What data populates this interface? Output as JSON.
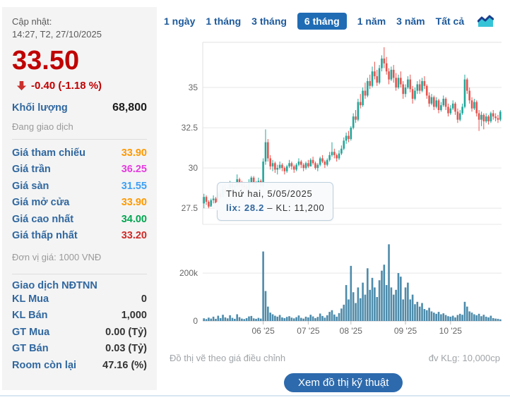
{
  "panel": {
    "updated_label": "Cập nhật:",
    "updated_time": "14:27, T2, 27/10/2025",
    "price": "33.50",
    "change": "-0.40 (-1.18 %)",
    "volume_label": "Khối lượng",
    "volume_value": "68,800",
    "session_status": "Đang giao dịch",
    "price_rows": [
      {
        "label": "Giá tham chiếu",
        "value": "33.90",
        "color": "#ff9900"
      },
      {
        "label": "Giá trần",
        "value": "36.25",
        "color": "#e53ce0"
      },
      {
        "label": "Giá sàn",
        "value": "31.55",
        "color": "#3da0f5"
      },
      {
        "label": "Giá mở cửa",
        "value": "33.90",
        "color": "#ff9900"
      },
      {
        "label": "Giá cao nhất",
        "value": "34.00",
        "color": "#00a651"
      },
      {
        "label": "Giá thấp nhất",
        "value": "33.20",
        "color": "#cf2a27"
      }
    ],
    "unit_note": "Đơn vị giá: 1000 VNĐ",
    "foreign_title": "Giao dịch NĐTNN",
    "foreign_rows": [
      {
        "label": "KL Mua",
        "value": "0"
      },
      {
        "label": "KL Bán",
        "value": "1,000"
      },
      {
        "label": "GT Mua",
        "value": "0.00 (Tỷ)"
      },
      {
        "label": "GT Bán",
        "value": "0.03 (Tỷ)"
      },
      {
        "label": "Room còn lại",
        "value": "47.16 (%)"
      }
    ]
  },
  "tabs": {
    "items": [
      "1 ngày",
      "1 tháng",
      "3 tháng",
      "6 tháng",
      "1 năm",
      "3 năm",
      "Tất cả"
    ],
    "active": "6 tháng",
    "chart_icon": "area-chart-icon"
  },
  "tooltip": {
    "date": "Thứ hai, 5/05/2025",
    "symbol_value": "lix: 28.2",
    "rest": " – KL: 11,200"
  },
  "footer": {
    "note_left": "Đồ thị vẽ theo giá điều chỉnh",
    "note_right": "đv KLg: 10,000cp",
    "button": "Xem đồ thị kỹ thuật"
  },
  "chart_data": {
    "type": "candlestick+volume",
    "title": "",
    "price_axis": {
      "min": 26.5,
      "max": 37.5,
      "ticks": [
        27.5,
        30,
        32.5,
        35
      ],
      "tick_labels": [
        "27.5",
        "30",
        "32.5",
        "35"
      ]
    },
    "volume_axis": {
      "max": 368000,
      "ticks": [
        0,
        200000
      ],
      "tick_labels": [
        "0",
        "200k"
      ]
    },
    "x_ticks": [
      {
        "index": 25,
        "label": "06 '25"
      },
      {
        "index": 44,
        "label": "07 '25"
      },
      {
        "index": 62,
        "label": "08 '25"
      },
      {
        "index": 85,
        "label": "09 '25"
      },
      {
        "index": 104,
        "label": "10 '25"
      }
    ],
    "colors": {
      "up": "#21a79b",
      "down": "#e8534e",
      "volume": "#4d8bab",
      "grid": "#e7e7e7",
      "axis_text": "#666666"
    },
    "legend": "ohlcv per trading day, May 5 2025 - Oct 27 2025, volume unit 10,000cp",
    "candles": [
      [
        27.8,
        28.4,
        27.5,
        28.2,
        11200
      ],
      [
        28.2,
        28.3,
        27.7,
        27.9,
        8000
      ],
      [
        27.9,
        28.0,
        27.5,
        27.6,
        14000
      ],
      [
        27.6,
        28.1,
        27.6,
        28.0,
        10000
      ],
      [
        28.0,
        28.3,
        27.8,
        28.1,
        18000
      ],
      [
        28.1,
        28.2,
        27.7,
        27.8,
        9000
      ],
      [
        27.8,
        28.5,
        27.8,
        28.4,
        22000
      ],
      [
        28.4,
        28.6,
        28.1,
        28.2,
        12000
      ],
      [
        28.2,
        28.9,
        28.2,
        28.7,
        26000
      ],
      [
        28.7,
        29.0,
        28.4,
        28.5,
        15000
      ],
      [
        28.5,
        28.8,
        28.3,
        28.6,
        11000
      ],
      [
        28.6,
        29.2,
        28.5,
        29.0,
        24000
      ],
      [
        29.0,
        29.1,
        28.6,
        28.8,
        13000
      ],
      [
        28.8,
        29.0,
        28.5,
        28.9,
        9000
      ],
      [
        28.9,
        29.6,
        28.8,
        29.3,
        28000
      ],
      [
        29.3,
        29.4,
        28.8,
        29.0,
        16000
      ],
      [
        29.0,
        29.2,
        28.7,
        28.9,
        10000
      ],
      [
        28.9,
        29.1,
        28.6,
        28.8,
        8000
      ],
      [
        28.8,
        29.0,
        28.5,
        28.7,
        12000
      ],
      [
        28.7,
        29.3,
        28.6,
        29.1,
        19000
      ],
      [
        29.1,
        29.5,
        29.0,
        29.4,
        21000
      ],
      [
        29.4,
        29.5,
        28.9,
        29.0,
        11000
      ],
      [
        29.0,
        29.2,
        28.8,
        29.1,
        9000
      ],
      [
        29.1,
        29.4,
        29.0,
        29.2,
        13000
      ],
      [
        29.2,
        29.3,
        28.8,
        28.9,
        10000
      ],
      [
        28.9,
        30.6,
        28.8,
        30.4,
        290000
      ],
      [
        30.4,
        32.4,
        30.2,
        31.6,
        125000
      ],
      [
        31.6,
        31.8,
        30.4,
        30.6,
        60000
      ],
      [
        30.6,
        30.8,
        29.9,
        30.1,
        35000
      ],
      [
        30.1,
        30.5,
        29.8,
        30.3,
        28000
      ],
      [
        30.3,
        30.4,
        29.7,
        29.9,
        22000
      ],
      [
        29.9,
        30.2,
        29.6,
        30.0,
        18000
      ],
      [
        30.0,
        30.4,
        29.9,
        30.2,
        25000
      ],
      [
        30.2,
        30.3,
        29.8,
        30.0,
        15000
      ],
      [
        30.0,
        30.1,
        29.6,
        29.8,
        12000
      ],
      [
        29.8,
        30.2,
        29.7,
        30.1,
        17000
      ],
      [
        30.1,
        30.5,
        30.0,
        30.3,
        20000
      ],
      [
        30.3,
        30.4,
        29.9,
        30.1,
        14000
      ],
      [
        30.1,
        30.2,
        29.7,
        29.9,
        11000
      ],
      [
        29.9,
        30.3,
        29.8,
        30.2,
        16000
      ],
      [
        30.2,
        30.6,
        30.1,
        30.4,
        23000
      ],
      [
        30.4,
        30.5,
        30.0,
        30.2,
        13000
      ],
      [
        30.2,
        30.3,
        29.8,
        30.0,
        10000
      ],
      [
        30.0,
        30.4,
        29.9,
        30.3,
        18000
      ],
      [
        30.3,
        30.5,
        30.0,
        30.1,
        15000
      ],
      [
        30.1,
        30.6,
        30.1,
        30.5,
        26000
      ],
      [
        30.5,
        30.7,
        30.2,
        30.3,
        19000
      ],
      [
        30.3,
        30.4,
        29.9,
        30.0,
        12000
      ],
      [
        30.0,
        30.3,
        29.8,
        30.2,
        17000
      ],
      [
        30.2,
        30.7,
        30.1,
        30.6,
        31000
      ],
      [
        30.6,
        30.8,
        30.3,
        30.4,
        21000
      ],
      [
        30.4,
        30.5,
        30.0,
        30.2,
        14000
      ],
      [
        30.2,
        30.6,
        30.1,
        30.5,
        24000
      ],
      [
        30.5,
        31.0,
        30.4,
        30.8,
        38000
      ],
      [
        30.8,
        31.6,
        30.7,
        31.0,
        45000
      ],
      [
        31.0,
        31.2,
        30.6,
        30.8,
        27000
      ],
      [
        30.8,
        30.9,
        30.4,
        30.6,
        18000
      ],
      [
        30.6,
        31.1,
        30.5,
        30.9,
        33000
      ],
      [
        30.9,
        31.4,
        30.8,
        31.2,
        52000
      ],
      [
        31.2,
        31.9,
        31.1,
        31.7,
        68000
      ],
      [
        31.7,
        32.2,
        31.5,
        32.0,
        150000
      ],
      [
        32.0,
        32.3,
        31.6,
        31.8,
        90000
      ],
      [
        31.8,
        32.6,
        31.7,
        32.5,
        230000
      ],
      [
        32.5,
        33.4,
        32.4,
        33.2,
        120000
      ],
      [
        33.2,
        33.6,
        32.8,
        33.0,
        75000
      ],
      [
        33.0,
        34.3,
        32.9,
        34.1,
        140000
      ],
      [
        34.1,
        34.6,
        33.7,
        33.9,
        95000
      ],
      [
        33.9,
        35.0,
        33.8,
        34.8,
        160000
      ],
      [
        34.8,
        35.3,
        34.3,
        34.5,
        110000
      ],
      [
        34.5,
        35.6,
        34.4,
        35.4,
        220000
      ],
      [
        35.4,
        35.8,
        34.9,
        35.1,
        130000
      ],
      [
        35.1,
        36.3,
        35.0,
        36.0,
        180000
      ],
      [
        36.0,
        36.6,
        35.5,
        35.7,
        140000
      ],
      [
        35.7,
        36.1,
        35.1,
        35.3,
        100000
      ],
      [
        35.3,
        36.4,
        35.2,
        36.2,
        170000
      ],
      [
        36.2,
        37.0,
        36.0,
        36.8,
        210000
      ],
      [
        36.8,
        37.5,
        36.2,
        36.5,
        235000
      ],
      [
        36.5,
        36.9,
        35.8,
        36.0,
        150000
      ],
      [
        36.0,
        36.2,
        35.2,
        35.5,
        320000
      ],
      [
        35.5,
        36.3,
        35.4,
        36.1,
        140000
      ],
      [
        36.1,
        36.4,
        35.3,
        35.6,
        110000
      ],
      [
        35.6,
        35.9,
        34.8,
        35.0,
        130000
      ],
      [
        35.0,
        35.8,
        34.9,
        35.6,
        200000
      ],
      [
        35.6,
        36.0,
        35.0,
        35.2,
        185000
      ],
      [
        35.2,
        35.4,
        34.3,
        34.6,
        90000
      ],
      [
        34.6,
        35.2,
        34.4,
        35.0,
        140000
      ],
      [
        35.0,
        35.7,
        34.9,
        35.5,
        160000
      ],
      [
        35.5,
        35.8,
        34.7,
        34.9,
        90000
      ],
      [
        34.9,
        35.1,
        34.0,
        34.3,
        110000
      ],
      [
        34.3,
        35.0,
        34.2,
        34.8,
        70000
      ],
      [
        34.8,
        35.4,
        34.6,
        35.2,
        80000
      ],
      [
        35.2,
        35.5,
        34.6,
        34.8,
        60000
      ],
      [
        34.8,
        35.6,
        34.7,
        35.4,
        75000
      ],
      [
        35.4,
        35.7,
        34.9,
        35.1,
        50000
      ],
      [
        35.1,
        35.2,
        34.3,
        34.5,
        45000
      ],
      [
        34.5,
        34.7,
        33.8,
        34.0,
        55000
      ],
      [
        34.0,
        34.6,
        33.9,
        34.4,
        40000
      ],
      [
        34.4,
        34.5,
        33.6,
        33.8,
        35000
      ],
      [
        33.8,
        34.4,
        33.7,
        34.2,
        30000
      ],
      [
        34.2,
        34.3,
        33.4,
        33.6,
        38000
      ],
      [
        33.6,
        34.1,
        33.5,
        33.9,
        28000
      ],
      [
        33.9,
        34.5,
        33.8,
        34.3,
        32000
      ],
      [
        34.3,
        34.4,
        33.6,
        33.8,
        25000
      ],
      [
        33.8,
        34.0,
        33.2,
        33.4,
        20000
      ],
      [
        33.4,
        33.9,
        33.3,
        33.7,
        18000
      ],
      [
        33.7,
        34.2,
        33.6,
        34.0,
        22000
      ],
      [
        34.0,
        34.1,
        33.3,
        33.5,
        15000
      ],
      [
        33.5,
        33.7,
        32.8,
        33.0,
        25000
      ],
      [
        33.0,
        33.6,
        32.9,
        33.4,
        30000
      ],
      [
        33.4,
        34.0,
        33.3,
        33.8,
        26000
      ],
      [
        33.8,
        35.8,
        33.7,
        35.5,
        80000
      ],
      [
        35.5,
        35.6,
        34.6,
        34.8,
        60000
      ],
      [
        34.8,
        35.0,
        34.0,
        34.2,
        40000
      ],
      [
        34.2,
        34.4,
        33.5,
        33.7,
        35000
      ],
      [
        33.7,
        34.3,
        33.6,
        34.1,
        28000
      ],
      [
        34.1,
        34.2,
        33.2,
        33.4,
        24000
      ],
      [
        33.4,
        33.6,
        32.3,
        33.0,
        30000
      ],
      [
        33.0,
        33.5,
        32.6,
        33.3,
        20000
      ],
      [
        33.3,
        33.4,
        32.4,
        32.9,
        26000
      ],
      [
        32.9,
        33.4,
        32.8,
        33.2,
        18000
      ],
      [
        33.2,
        33.3,
        32.7,
        32.9,
        15000
      ],
      [
        32.9,
        33.5,
        32.8,
        33.4,
        22000
      ],
      [
        33.4,
        33.6,
        33.0,
        33.2,
        12000
      ],
      [
        33.2,
        33.4,
        32.9,
        33.1,
        10000
      ],
      [
        33.1,
        33.3,
        32.8,
        33.0,
        9000
      ],
      [
        33.0,
        33.6,
        32.9,
        33.5,
        6880
      ]
    ]
  }
}
